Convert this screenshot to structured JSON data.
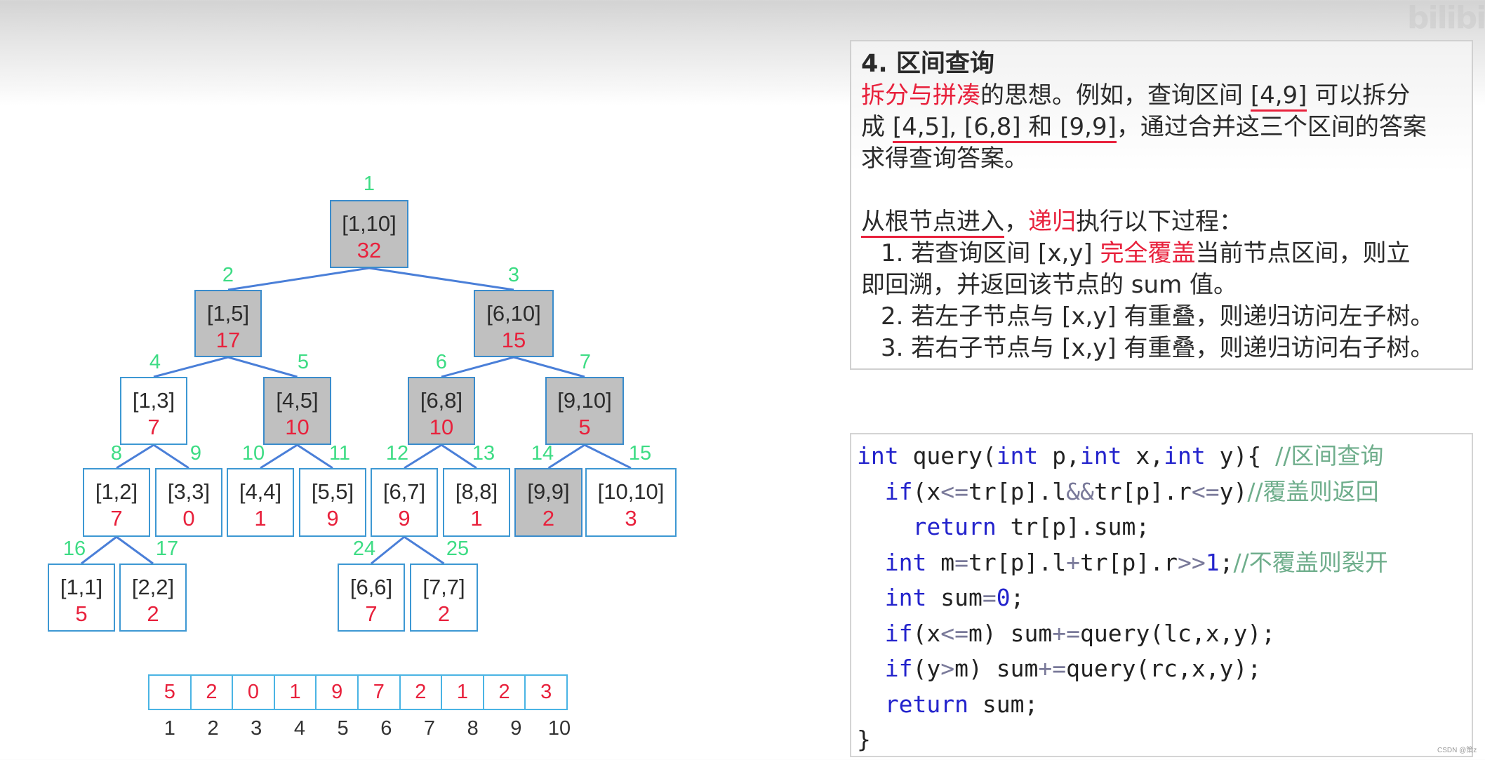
{
  "watermark_top": "bilibili",
  "watermark_bottom": "CSDN @策z",
  "colors": {
    "sum_red": "#e8213c",
    "index_green": "#3ddc84",
    "edge_blue": "#4a7fd8",
    "box_border": "#3d98d3",
    "covered_fill": "#c0c0c0",
    "keyword_blue": "#2323cc",
    "comment_green": "#6fae8c"
  },
  "tree": {
    "nodes": [
      {
        "id": 1,
        "range": "[1,10]",
        "sum": "32",
        "covered": true
      },
      {
        "id": 2,
        "range": "[1,5]",
        "sum": "17",
        "covered": true
      },
      {
        "id": 3,
        "range": "[6,10]",
        "sum": "15",
        "covered": true
      },
      {
        "id": 4,
        "range": "[1,3]",
        "sum": "7",
        "covered": false
      },
      {
        "id": 5,
        "range": "[4,5]",
        "sum": "10",
        "covered": true
      },
      {
        "id": 6,
        "range": "[6,8]",
        "sum": "10",
        "covered": true
      },
      {
        "id": 7,
        "range": "[9,10]",
        "sum": "5",
        "covered": true
      },
      {
        "id": 8,
        "range": "[1,2]",
        "sum": "7",
        "covered": false
      },
      {
        "id": 9,
        "range": "[3,3]",
        "sum": "0",
        "covered": false
      },
      {
        "id": 10,
        "range": "[4,4]",
        "sum": "1",
        "covered": false
      },
      {
        "id": 11,
        "range": "[5,5]",
        "sum": "9",
        "covered": false
      },
      {
        "id": 12,
        "range": "[6,7]",
        "sum": "9",
        "covered": false
      },
      {
        "id": 13,
        "range": "[8,8]",
        "sum": "1",
        "covered": false
      },
      {
        "id": 14,
        "range": "[9,9]",
        "sum": "2",
        "covered": true
      },
      {
        "id": 15,
        "range": "[10,10]",
        "sum": "3",
        "covered": false
      },
      {
        "id": 16,
        "range": "[1,1]",
        "sum": "5",
        "covered": false
      },
      {
        "id": 17,
        "range": "[2,2]",
        "sum": "2",
        "covered": false
      },
      {
        "id": 24,
        "range": "[6,6]",
        "sum": "7",
        "covered": false
      },
      {
        "id": 25,
        "range": "[7,7]",
        "sum": "2",
        "covered": false
      }
    ]
  },
  "array": {
    "values": [
      "5",
      "2",
      "0",
      "1",
      "9",
      "7",
      "2",
      "1",
      "2",
      "3"
    ],
    "indices": [
      "1",
      "2",
      "3",
      "4",
      "5",
      "6",
      "7",
      "8",
      "9",
      "10"
    ]
  },
  "explanation": {
    "title": "4.  区间查询",
    "p1_red": "拆分与拼凑",
    "p1_a": "的思想。例如，查询区间 ",
    "p1_q": "[4,9]",
    "p1_b": " 可以拆分",
    "p1_c": "成 ",
    "p1_parts": "[4,5], [6,8] 和 [9,9]",
    "p1_d": "，通过合并这三个区间的答案",
    "p1_e": "求得查询答案。",
    "p2_ul": "从根节点进入",
    "p2_a": "，",
    "p2_red": "递归",
    "p2_b": "执行以下过程：",
    "s1_a": "1. 若查询区间 [x,y] ",
    "s1_red": "完全覆盖",
    "s1_b": "当前节点区间，则立",
    "s1_c": "即回溯，并返回该节点的 sum 值。",
    "s2": "2. 若左子节点与 [x,y] 有重叠，则递归访问左子树。",
    "s3": "3. 若右子节点与 [x,y] 有重叠，则递归访问右子树。"
  },
  "code": {
    "l1_kw1": "int",
    "l1_a": " query(",
    "l1_kw2": "int",
    "l1_b": " p,",
    "l1_kw3": "int",
    "l1_c": " x,",
    "l1_kw4": "int",
    "l1_d": " y){ ",
    "l1_cm": "//区间查询",
    "l2_kw": "if",
    "l2_a": "(x",
    "l2_op1": "<=",
    "l2_b": "tr[p].l",
    "l2_op2": "&&",
    "l2_c": "tr[p].r",
    "l2_op3": "<=",
    "l2_d": "y)",
    "l2_cm": "//覆盖则返回",
    "l3_kw": "return",
    "l3_a": " tr[p].sum;",
    "l4_kw": "int",
    "l4_a": " m",
    "l4_op1": "=",
    "l4_b": "tr[p].l",
    "l4_op2": "+",
    "l4_c": "tr[p].r",
    "l4_op3": ">>",
    "l4_num": "1",
    "l4_d": ";",
    "l4_cm": "//不覆盖则裂开",
    "l5_kw": "int",
    "l5_a": " sum",
    "l5_op": "=",
    "l5_num": "0",
    "l5_b": ";",
    "l6_kw": "if",
    "l6_a": "(x",
    "l6_op1": "<=",
    "l6_b": "m) sum",
    "l6_op2": "+=",
    "l6_c": "query(lc,x,y);",
    "l7_kw": "if",
    "l7_a": "(y",
    "l7_op1": ">",
    "l7_b": "m) sum",
    "l7_op2": "+=",
    "l7_c": "query(rc,x,y);",
    "l8_kw": "return",
    "l8_a": " sum;",
    "l9": "}"
  }
}
